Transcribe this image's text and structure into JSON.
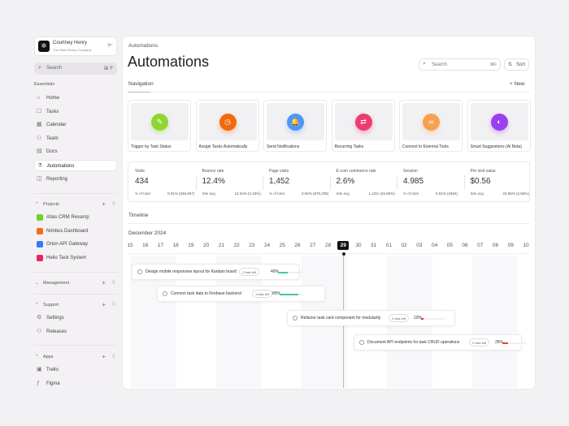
{
  "user": {
    "name": "Courtney Henry",
    "company": "The Walt Disney Company"
  },
  "sidebar": {
    "search_placeholder": "Search",
    "search_shortcut": "⌘ F",
    "essentials_label": "Essentials",
    "items": [
      {
        "label": "Home",
        "icon": "⌂"
      },
      {
        "label": "Tasks",
        "icon": "☐"
      },
      {
        "label": "Calendar",
        "icon": "▦"
      },
      {
        "label": "Team",
        "icon": "⚇"
      },
      {
        "label": "Docs",
        "icon": "▤"
      },
      {
        "label": "Automations",
        "icon": "⚗"
      },
      {
        "label": "Reporting",
        "icon": "◫"
      }
    ],
    "projects_label": "Projects",
    "projects": [
      {
        "label": "Atlas CRM Revamp",
        "color": "#6fd12b"
      },
      {
        "label": "Nimbus Dashboard",
        "color": "#f26b1d"
      },
      {
        "label": "Orion API Gateway",
        "color": "#2f7cf6"
      },
      {
        "label": "Helio Task System",
        "color": "#e8245e"
      }
    ],
    "management_label": "Management",
    "support_label": "Support",
    "support_items": [
      {
        "label": "Settings",
        "icon": "⚙"
      },
      {
        "label": "Releases",
        "icon": "⚇"
      }
    ],
    "apps_label": "Apps",
    "apps": [
      {
        "label": "Trello",
        "icon": "▣"
      },
      {
        "label": "Figma",
        "icon": "ƒ"
      }
    ]
  },
  "main": {
    "breadcrumb": "Automations",
    "title": "Automations",
    "search_placeholder": "Search",
    "search_shortcut": "⌘F",
    "sort_label": "Sort",
    "nav_tab": "Navigation",
    "new_label": "New",
    "cards": [
      {
        "label": "Trigger by Task Status",
        "color": "#8fd630",
        "icon": "✎"
      },
      {
        "label": "Assign Tasks Automatically",
        "color": "#f26a0d",
        "icon": "◷"
      },
      {
        "label": "Send Notifications",
        "color": "#4f96f7",
        "icon": "🔔"
      },
      {
        "label": "Recurring Tasks",
        "color": "#ee3c6e",
        "icon": "⇄"
      },
      {
        "label": "Connect to External Tools",
        "color": "#f6a150",
        "icon": "∞"
      },
      {
        "label": "Smart Suggestions (AI Beta)",
        "color": "#9b3ff0",
        "icon": "◐"
      }
    ],
    "stats": [
      {
        "title": "Visits",
        "value": "434",
        "k": "% of total",
        "kv": "0.01% (345,657)"
      },
      {
        "title": "Bounce rate",
        "value": "12.4%",
        "k": "Site avg",
        "kv": "12.34% (2.43%)"
      },
      {
        "title": "Page visits",
        "value": "1,452",
        "k": "% of total",
        "kv": "0.02% (876,235)"
      },
      {
        "title": "E-com commerce rate",
        "value": "2.6%",
        "k": "Site avg",
        "kv": "1.12% (34.65%)"
      },
      {
        "title": "Session",
        "value": "4.985",
        "k": "% of total",
        "kv": "0.01% (3454)"
      },
      {
        "title": "Per visit value",
        "value": "$0.56",
        "k": "Site avg",
        "kv": "23.56% (2.56%)"
      }
    ],
    "timeline_label": "Timeline",
    "month": "December 2024",
    "days": [
      "15",
      "16",
      "17",
      "18",
      "19",
      "20",
      "21",
      "22",
      "23",
      "24",
      "25",
      "26",
      "27",
      "28",
      "29",
      "30",
      "31",
      "01",
      "02",
      "03",
      "04",
      "05",
      "06",
      "07",
      "08",
      "09",
      "10"
    ],
    "today": "29",
    "tasks": [
      {
        "name": "Design mobile responsive layout for Kanban board",
        "badge": "2 task left",
        "pct": "40%",
        "progress": 40,
        "color": "#3ecf8e"
      },
      {
        "name": "Connect task data to Firebase backend",
        "badge": "1 task left",
        "pct": "80%",
        "progress": 80,
        "color": "#3ecf8e"
      },
      {
        "name": "Refactor task card component for modularity",
        "badge": "2 task left",
        "pct": "10%",
        "progress": 10,
        "color": "#f0244f"
      },
      {
        "name": "Document API endpoints for task CRUD operations",
        "badge": "2 task left",
        "pct": "25%",
        "progress": 25,
        "color": "#f0441a"
      }
    ]
  }
}
